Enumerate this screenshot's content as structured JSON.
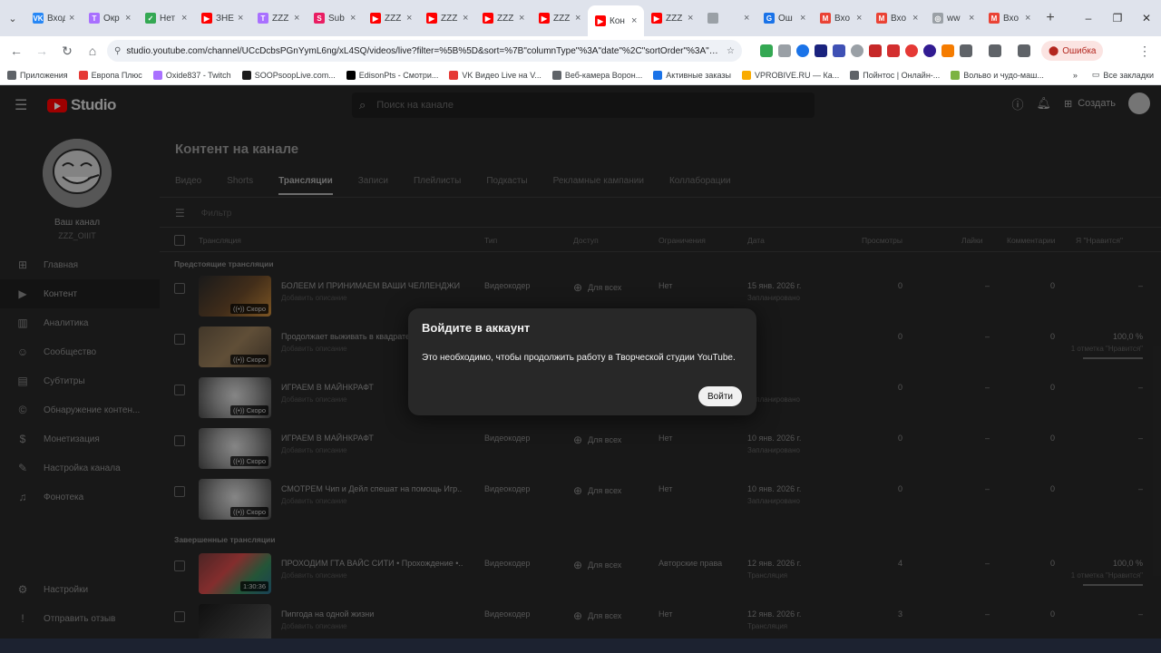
{
  "browser": {
    "tabs": [
      {
        "label": "Вход",
        "color": "#2787f5",
        "glyph": "VK"
      },
      {
        "label": "Окр",
        "color": "#a970ff",
        "glyph": "T"
      },
      {
        "label": "Нет",
        "color": "#34a853",
        "glyph": "✓"
      },
      {
        "label": "ЗНЕ",
        "color": "#ff0000",
        "glyph": "▶"
      },
      {
        "label": "ZZZ",
        "color": "#a970ff",
        "glyph": "T"
      },
      {
        "label": "Sub",
        "color": "#e91e63",
        "glyph": "S"
      },
      {
        "label": "ZZZ",
        "color": "#ff0000",
        "glyph": "▶"
      },
      {
        "label": "ZZZ",
        "color": "#ff0000",
        "glyph": "▶"
      },
      {
        "label": "ZZZ",
        "color": "#ff0000",
        "glyph": "▶"
      },
      {
        "label": "ZZZ",
        "color": "#ff0000",
        "glyph": "▶"
      },
      {
        "label": "Кон",
        "color": "#ff0000",
        "glyph": "▶",
        "active": true
      },
      {
        "label": "ZZZ",
        "color": "#ff0000",
        "glyph": "▶"
      },
      {
        "label": "",
        "color": "#9aa0a6",
        "glyph": ""
      },
      {
        "label": "Ош",
        "color": "#1a73e8",
        "glyph": "G"
      },
      {
        "label": "Вхо",
        "color": "#ea4335",
        "glyph": "M"
      },
      {
        "label": "Вхо",
        "color": "#ea4335",
        "glyph": "M"
      },
      {
        "label": "ww",
        "color": "#9aa0a6",
        "glyph": "◎"
      },
      {
        "label": "Вхо",
        "color": "#ea4335",
        "glyph": "M"
      }
    ],
    "url": "studio.youtube.com/channel/UCcDcbsPGnYymL6ng/xL4SQ/videos/live?filter=%5B%5D&sort=%7B\"columnType\"%3A\"date\"%2C\"sortOrder\"%3A\"DESCENDING\"...",
    "error_label": "Ошибка",
    "bookmarks": [
      {
        "label": "Приложения",
        "color": "#5f6368"
      },
      {
        "label": "Европа Плюс",
        "color": "#e53935"
      },
      {
        "label": "Oxide837 - Twitch",
        "color": "#a970ff"
      },
      {
        "label": "SOOPsoopLive.com...",
        "color": "#1b1b1b"
      },
      {
        "label": "EdisonPts - Смотри...",
        "color": "#000000"
      },
      {
        "label": "VK Видео Live на V...",
        "color": "#e53935"
      },
      {
        "label": "Веб-камера Ворон...",
        "color": "#5f6368"
      },
      {
        "label": "Активные заказы",
        "color": "#1a73e8"
      },
      {
        "label": "VPROBIVE.RU — Ка...",
        "color": "#f9ab00"
      },
      {
        "label": "Пойнтос | Онлайн-...",
        "color": "#5f6368"
      },
      {
        "label": "Вольво и чудо-маш...",
        "color": "#7cb342"
      }
    ],
    "all_bookmarks": "Все закладки"
  },
  "studio": {
    "logo_text": "Studio",
    "search_placeholder": "Поиск на канале",
    "create_label": "Создать",
    "channel_name": "Ваш канал",
    "channel_handle": "ZZZ_OIIIT",
    "nav": [
      {
        "label": "Главная",
        "icon": "⊞",
        "name": "dashboard"
      },
      {
        "label": "Контент",
        "icon": "▶",
        "name": "content",
        "active": true
      },
      {
        "label": "Аналитика",
        "icon": "▥",
        "name": "analytics"
      },
      {
        "label": "Сообщество",
        "icon": "☺",
        "name": "community"
      },
      {
        "label": "Субтитры",
        "icon": "▤",
        "name": "subtitles"
      },
      {
        "label": "Обнаружение контен...",
        "icon": "©",
        "name": "content-detection"
      },
      {
        "label": "Монетизация",
        "icon": "$",
        "name": "monetization"
      },
      {
        "label": "Настройка канала",
        "icon": "✎",
        "name": "customization"
      },
      {
        "label": "Фонотека",
        "icon": "♫",
        "name": "audio-library"
      }
    ],
    "nav_bottom": [
      {
        "label": "Настройки",
        "icon": "⚙",
        "name": "settings"
      },
      {
        "label": "Отправить отзыв",
        "icon": "!",
        "name": "feedback"
      }
    ],
    "page_title": "Контент на канале",
    "tabs": [
      {
        "label": "Видео"
      },
      {
        "label": "Shorts"
      },
      {
        "label": "Трансляции",
        "active": true
      },
      {
        "label": "Записи"
      },
      {
        "label": "Плейлисты"
      },
      {
        "label": "Подкасты"
      },
      {
        "label": "Рекламные кампании"
      },
      {
        "label": "Коллаборации"
      }
    ],
    "filter_label": "Фильтр",
    "columns": {
      "stream": "Трансляция",
      "type": "Тип",
      "access": "Доступ",
      "restrictions": "Ограничения",
      "date": "Дата",
      "views": "Просмотры",
      "likes_dislikes": "Лайки",
      "comments": "Комментарии",
      "like_ratio": "Я \"Нравится\""
    },
    "section_upcoming": "Предстоящие трансляции",
    "section_finished": "Завершенные трансляции",
    "rows_upcoming": [
      {
        "title": "БОЛЕЕМ И ПРИНИМАЕМ ВАШИ ЧЕЛЛЕНДЖИ",
        "desc": "Добавить описание",
        "badge": "((•)) Скоро",
        "type": "Видеокодер",
        "access": "Для всех",
        "restriction": "Нет",
        "date": "15 янв. 2026 г.",
        "date_sub": "Запланировано",
        "views": "0",
        "likes": "–",
        "comments": "0",
        "ratio": "–",
        "thumb": "linear-gradient(135deg,#2a2a2a 0%,#6b4a2a 55%,#c98a3a 100%)"
      },
      {
        "title": "Продолжает выживать в квадрате ...",
        "desc": "Добавить описание",
        "badge": "((•)) Скоро",
        "type": "",
        "access": "",
        "restriction": "",
        "date": "",
        "date_sub": "",
        "views": "0",
        "likes": "–",
        "comments": "0",
        "ratio": "100,0 %",
        "ratio_sub": "1 отметка \"Нравится\"",
        "thumb": "linear-gradient(135deg,#6b5a44 0%,#9b7f5a 50%,#5a4b3a 100%)"
      },
      {
        "title": "ИГРАЕМ В МАЙНКРАФТ",
        "desc": "Добавить описание",
        "badge": "((•)) Скоро",
        "type": "",
        "access": "",
        "restriction": "",
        "date": "",
        "date_sub": "Запланировано",
        "views": "0",
        "likes": "–",
        "comments": "0",
        "ratio": "–",
        "thumb": "radial-gradient(circle at 50% 45%,#d8d8d8 0%,#a0a0a0 45%,#4a4a4a 100%)"
      },
      {
        "title": "ИГРАЕМ В МАЙНКРАФТ",
        "desc": "Добавить описание",
        "badge": "((•)) Скоро",
        "type": "Видеокодер",
        "access": "Для всех",
        "restriction": "Нет",
        "date": "10 янв. 2026 г.",
        "date_sub": "Запланировано",
        "views": "0",
        "likes": "–",
        "comments": "0",
        "ratio": "–",
        "thumb": "radial-gradient(circle at 50% 45%,#d8d8d8 0%,#a0a0a0 45%,#4a4a4a 100%)"
      },
      {
        "title": "СМОТРЕМ Чип и Дейл спешат на помощь Игр...",
        "desc": "Добавить описание",
        "badge": "((•)) Скоро",
        "type": "Видеокодер",
        "access": "Для всех",
        "restriction": "Нет",
        "date": "10 янв. 2026 г.",
        "date_sub": "Запланировано",
        "views": "0",
        "likes": "–",
        "comments": "0",
        "ratio": "–",
        "thumb": "radial-gradient(circle at 50% 45%,#d8d8d8 0%,#a0a0a0 45%,#4a4a4a 100%)"
      }
    ],
    "rows_finished": [
      {
        "title": "ПРОХОДИМ ГТА ВАЙС СИТИ • Прохождение •...",
        "desc": "Добавить описание",
        "badge": "1:30:36",
        "type": "Видеокодер",
        "access": "Для всех",
        "restriction": "Авторские права",
        "date": "12 янв. 2026 г.",
        "date_sub": "Трансляция",
        "views": "4",
        "likes": "–",
        "comments": "0",
        "ratio": "100,0 %",
        "ratio_sub": "1 отметка \"Нравится\"",
        "thumb": "linear-gradient(135deg,#7a3b3b 0%,#d44a4a 40%,#3a8a5a 70%,#2a6a8a 100%)"
      },
      {
        "title": "Пипгода на одной жизни",
        "desc": "Добавить описание",
        "badge": "",
        "type": "Видеокодер",
        "access": "Для всех",
        "restriction": "Нет",
        "date": "12 янв. 2026 г.",
        "date_sub": "Трансляция",
        "views": "3",
        "likes": "–",
        "comments": "0",
        "ratio": "–",
        "thumb": "linear-gradient(135deg,#1a1a1a 0%,#3a3a3a 50%,#5a5a5a 100%)"
      }
    ]
  },
  "dialog": {
    "title": "Войдите в аккаунт",
    "body": "Это необходимо, чтобы продолжить работу в Творческой студии YouTube.",
    "button": "Войти"
  }
}
